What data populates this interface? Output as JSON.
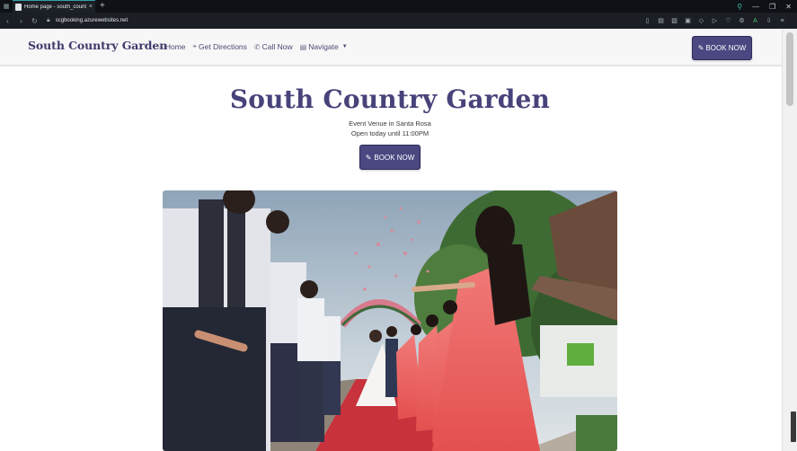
{
  "browser": {
    "tab_title": "Home page - south_country",
    "tab_close": "×",
    "new_tab": "+",
    "url": "scgbooking.azurewebsites.net",
    "icons": {
      "app": "grid-icon",
      "back": "back-arrow-icon",
      "forward": "forward-arrow-icon",
      "reload": "reload-icon",
      "lock": "lock-icon",
      "search": "search-icon",
      "minimize": "minimize-icon",
      "restore": "restore-icon",
      "close": "close-icon",
      "reader": "reader-mode-icon",
      "extensions": [
        "book-icon",
        "image-icon",
        "note-icon",
        "shield-icon",
        "play-icon",
        "heart-icon",
        "gear-icon",
        "account-icon",
        "download-icon",
        "menu-icon"
      ]
    }
  },
  "site": {
    "brand": "South Country Garden",
    "nav": {
      "home": "Home",
      "directions": "Get Directions",
      "call": "Call Now",
      "navigate": "Navigate"
    },
    "book_now": "BOOK NOW",
    "icons": {
      "home": "home-icon",
      "directions": "map-pin-icon",
      "call": "phone-icon",
      "navigate": "calendar-icon",
      "book": "edit-icon"
    }
  },
  "hero": {
    "title": "South Country Garden",
    "subtitle": "Event Venue in Santa Rosa",
    "hours": "Open today until 11:00PM",
    "button": "BOOK NOW"
  },
  "colors": {
    "brand": "#47437a",
    "button": "#4a4781",
    "navbar_bg": "#f7f7f8"
  }
}
